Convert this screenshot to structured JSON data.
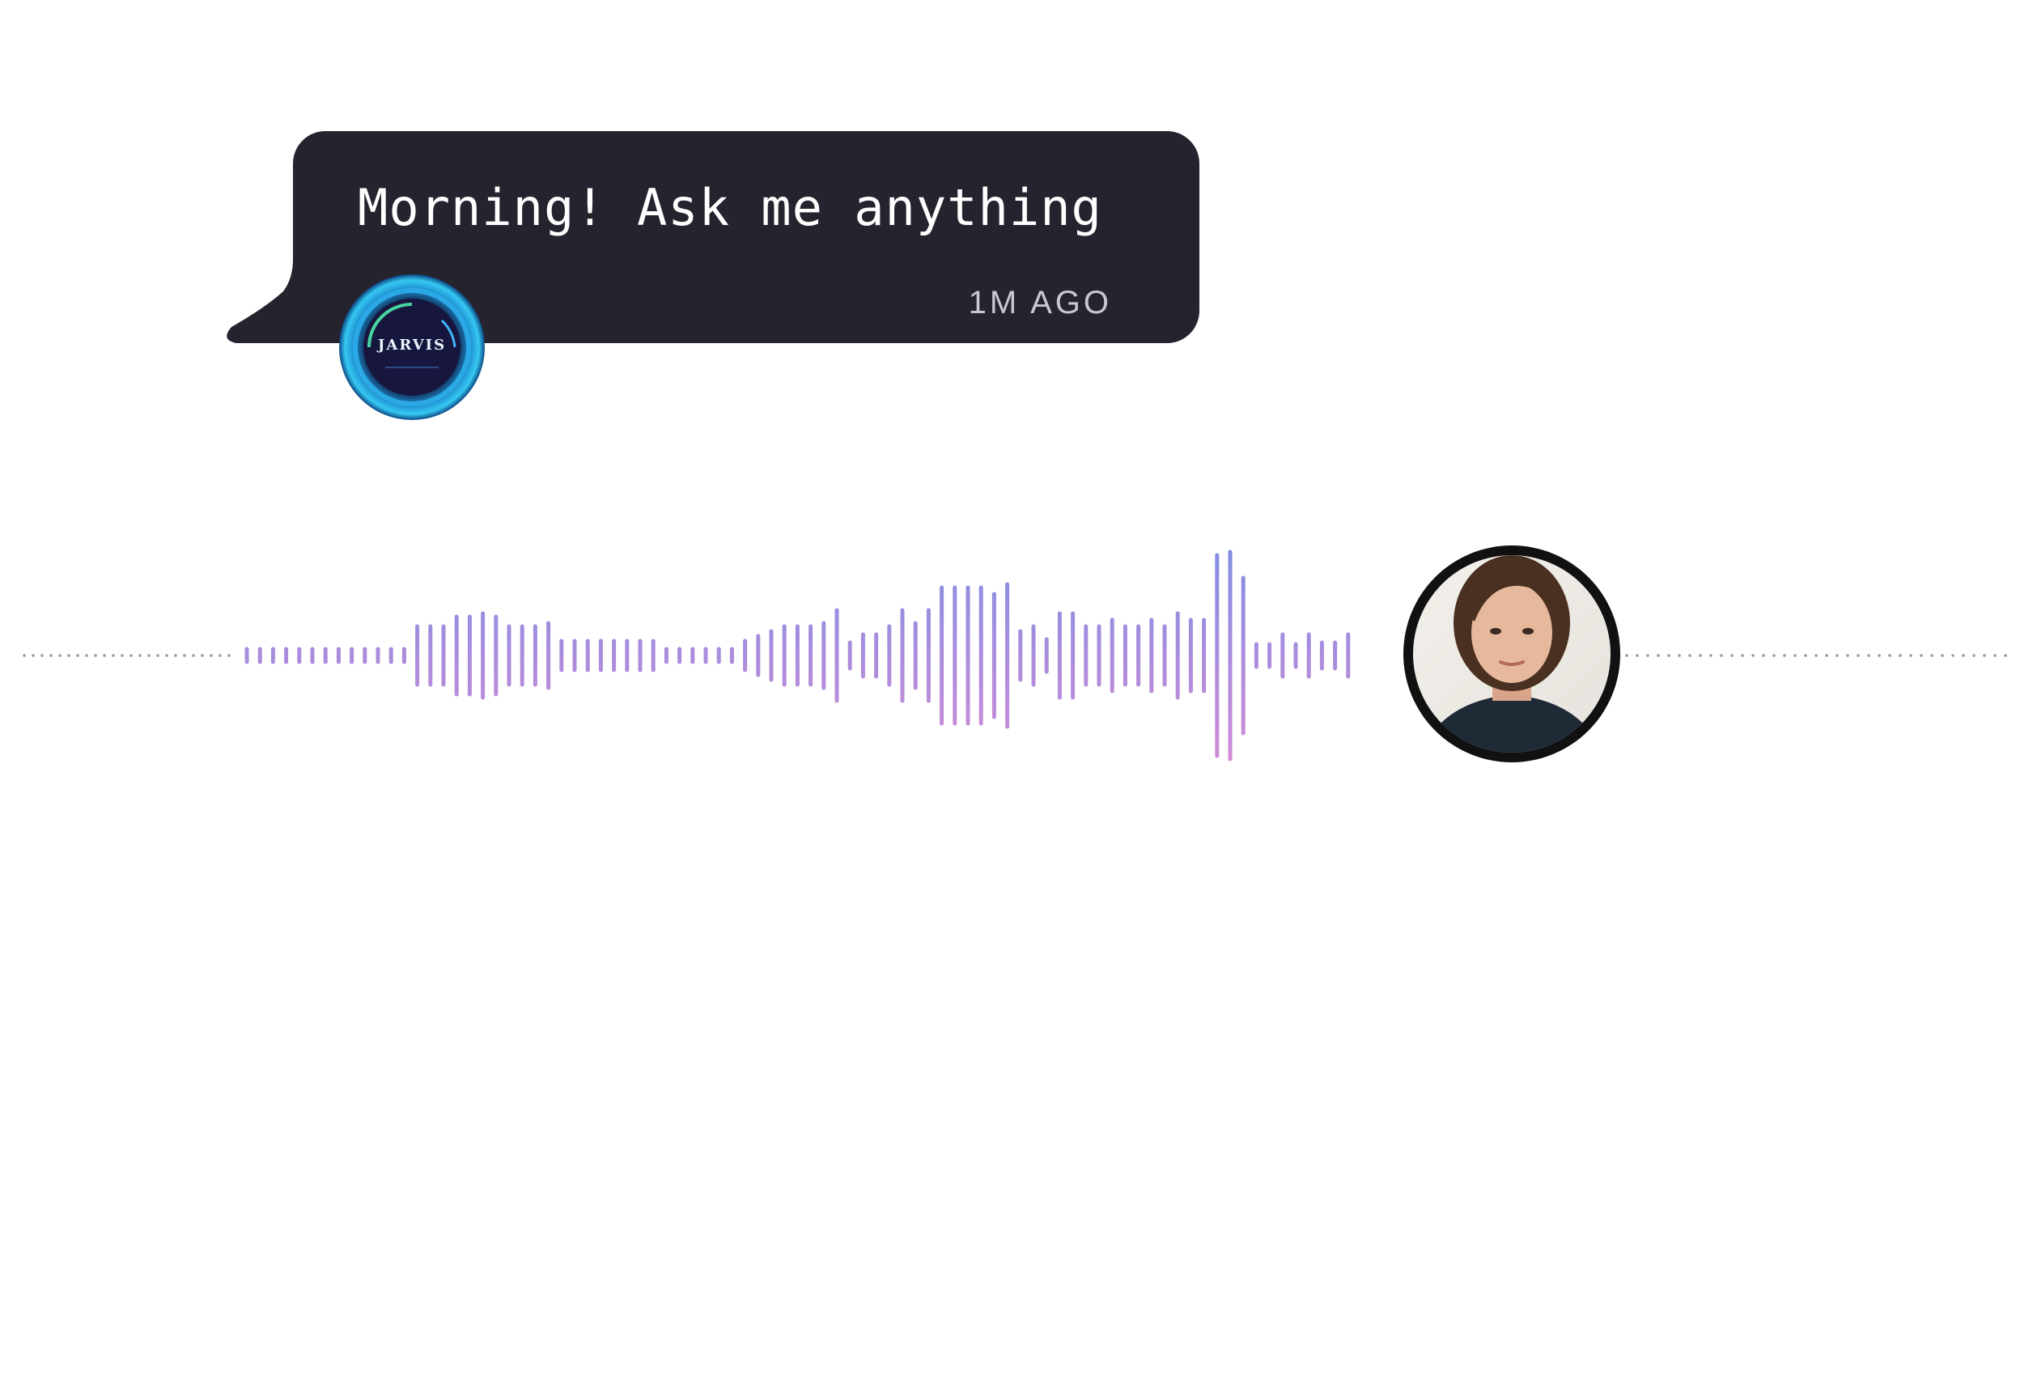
{
  "message": {
    "text": "Morning! Ask me anything",
    "timestamp": "1M AGO"
  },
  "assistant": {
    "avatar_label": "JARVIS",
    "avatar_icon": "jarvis-logo-icon"
  },
  "user": {
    "avatar_icon": "user-avatar-photo"
  },
  "colors": {
    "bubble": "#25232e",
    "wave_top": "#6a8fe6",
    "wave_bottom": "#ea8ad3",
    "assistant_ring": "#24b6ea"
  },
  "waveform": {
    "bar_levels": [
      0.04,
      0.04,
      0.04,
      0.04,
      0.04,
      0.04,
      0.04,
      0.04,
      0.04,
      0.04,
      0.04,
      0.04,
      0.04,
      0.18,
      0.18,
      0.18,
      0.24,
      0.24,
      0.26,
      0.24,
      0.18,
      0.18,
      0.18,
      0.2,
      0.09,
      0.09,
      0.09,
      0.09,
      0.09,
      0.09,
      0.09,
      0.09,
      0.04,
      0.04,
      0.04,
      0.04,
      0.04,
      0.04,
      0.09,
      0.12,
      0.15,
      0.18,
      0.18,
      0.18,
      0.2,
      0.28,
      0.08,
      0.13,
      0.13,
      0.18,
      0.28,
      0.2,
      0.28,
      0.42,
      0.42,
      0.42,
      0.42,
      0.38,
      0.44,
      0.15,
      0.18,
      0.1,
      0.26,
      0.26,
      0.18,
      0.18,
      0.22,
      0.18,
      0.18,
      0.22,
      0.18,
      0.26,
      0.22,
      0.22,
      0.62,
      0.64,
      0.48,
      0.07,
      0.07,
      0.13,
      0.07,
      0.13,
      0.08,
      0.08,
      0.13
    ]
  }
}
